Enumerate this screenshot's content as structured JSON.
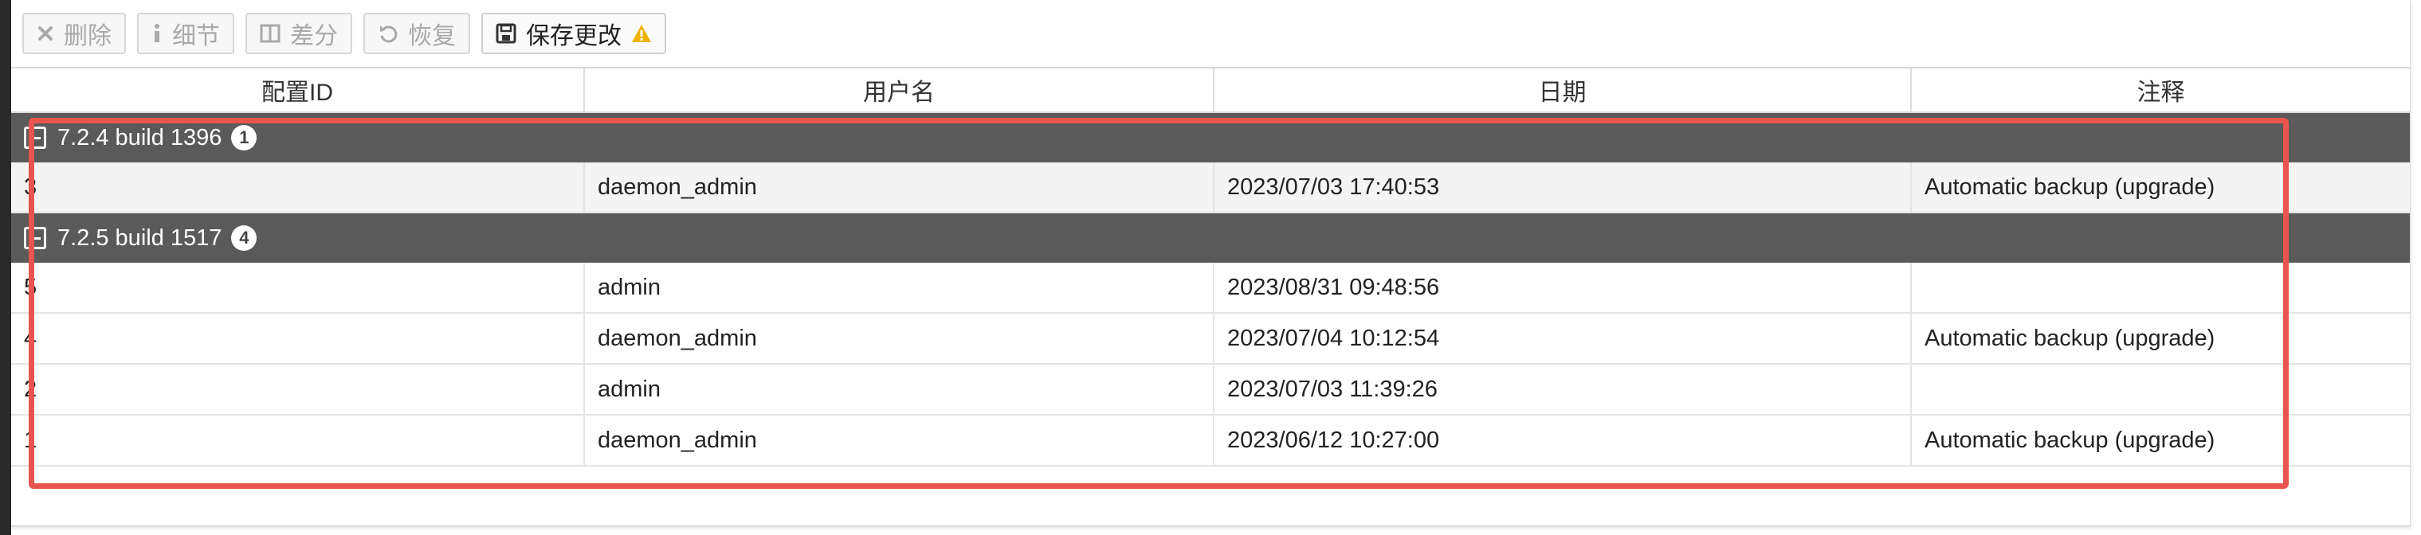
{
  "toolbar": {
    "delete_label": "删除",
    "details_label": "细节",
    "diff_label": "差分",
    "restore_label": "恢复",
    "save_label": "保存更改",
    "icons": [
      "close-icon",
      "info-icon",
      "columns-icon",
      "undo-icon",
      "save-icon",
      "warning-icon"
    ],
    "warning_color": "#f0b400"
  },
  "table": {
    "headers": [
      "配置ID",
      "用户名",
      "日期",
      "注释"
    ],
    "groups": [
      {
        "title": "7.2.4 build 1396",
        "count": "1",
        "rows": [
          [
            "3",
            "daemon_admin",
            "2023/07/03 17:40:53",
            "Automatic backup (upgrade)"
          ]
        ]
      },
      {
        "title": "7.2.5 build 1517",
        "count": "4",
        "rows": [
          [
            "5",
            "admin",
            "2023/08/31 09:48:56",
            ""
          ],
          [
            "4",
            "daemon_admin",
            "2023/07/04 10:12:54",
            "Automatic backup (upgrade)"
          ],
          [
            "2",
            "admin",
            "2023/07/03 11:39:26",
            ""
          ],
          [
            "1",
            "daemon_admin",
            "2023/06/12 10:27:00",
            "Automatic backup (upgrade)"
          ]
        ]
      }
    ]
  },
  "colors": {
    "group_header_bg": "#5a5a5a",
    "highlight_border": "#e8554e"
  }
}
